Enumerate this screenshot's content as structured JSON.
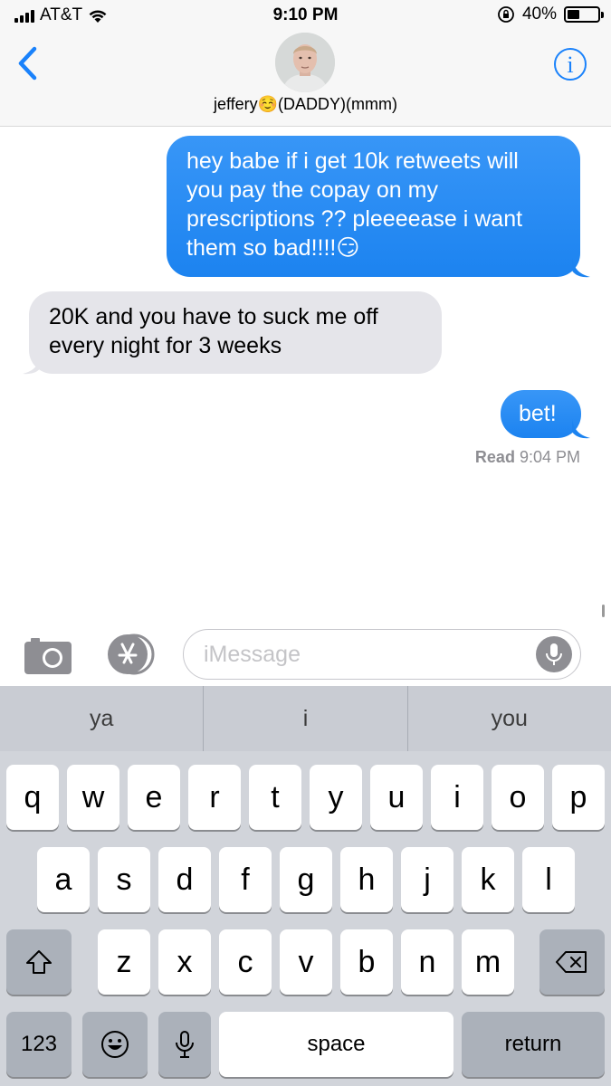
{
  "status_bar": {
    "carrier": "AT&T",
    "time": "9:10 PM",
    "battery_percent": "40%",
    "battery_level": 0.4,
    "icons": [
      "signal-icon",
      "wifi-icon",
      "orientation-lock-icon",
      "battery-icon"
    ]
  },
  "header": {
    "contact_name": "jeffery☺️(DADDY)(mmm)",
    "back_icon": "chevron-left-icon",
    "info_icon": "info-icon"
  },
  "messages": [
    {
      "direction": "outgoing",
      "lines": [
        "hey babe if i get 10k retweets will",
        "you pay the copay on my",
        "prescriptions ?? pleeeease i want",
        "them so bad!!!!😏"
      ]
    },
    {
      "direction": "incoming",
      "lines": [
        "20K and you have to suck me off",
        "every night for 3 weeks"
      ]
    },
    {
      "direction": "outgoing",
      "lines": [
        "bet!"
      ]
    }
  ],
  "read_receipt": {
    "label": "Read",
    "time": "9:04 PM"
  },
  "compose": {
    "placeholder": "iMessage",
    "icons": [
      "camera-icon",
      "app-store-icon",
      "microphone-icon"
    ]
  },
  "keyboard": {
    "predictions": [
      "ya",
      "i",
      "you"
    ],
    "row1": [
      "q",
      "w",
      "e",
      "r",
      "t",
      "y",
      "u",
      "i",
      "o",
      "p"
    ],
    "row2": [
      "a",
      "s",
      "d",
      "f",
      "g",
      "h",
      "j",
      "k",
      "l"
    ],
    "row3": [
      "z",
      "x",
      "c",
      "v",
      "b",
      "n",
      "m"
    ],
    "numbers_label": "123",
    "space_label": "space",
    "return_label": "return",
    "colors": {
      "outgoing_bubble": "#1c83f0",
      "incoming_bubble": "#e5e5ea",
      "accent": "#1a82fb"
    }
  }
}
